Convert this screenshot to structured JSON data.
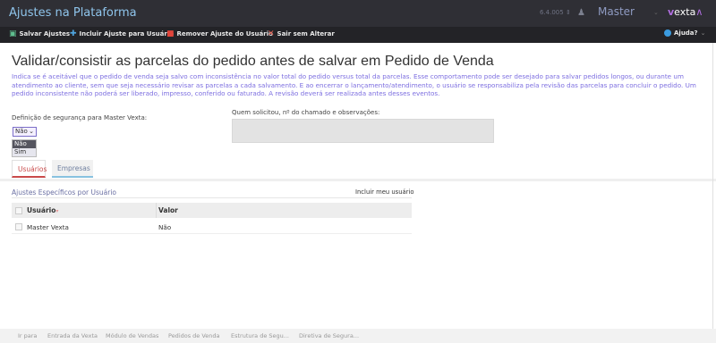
{
  "header": {
    "title": "Ajustes na Plataforma",
    "version": "6.4.005",
    "user": "Master",
    "logo_v": "v",
    "logo_rest": "exta"
  },
  "toolbar": {
    "save": "Salvar Ajustes",
    "include_user": "Incluir Ajuste para Usuário",
    "remove_user": "Remover Ajuste do Usuário",
    "exit": "Sair sem Alterar",
    "help": "Ajuda?"
  },
  "main": {
    "title": "Validar/consistir as parcelas do pedido antes de salvar em Pedido de Venda",
    "description": "Indica se é aceitável que o pedido de venda seja salvo com inconsistência no valor total do pedido versus total da parcelas. Esse comportamento pode ser desejado para salvar pedidos longos, ou durante um atendimento ao cliente, sem que seja necessário revisar as parcelas a cada salvamento. E ao encerrar o lançamento/atendimento, o usuário se responsabiliza pela revisão das parcelas para concluir o pedido. Um pedido inconsistente não poderá ser liberado, impresso, conferido ou faturado. A revisão deverá ser realizada antes desses eventos.",
    "security_label": "Definição de segurança para Master Vexta:",
    "security_value": "Não",
    "security_options": [
      "Não",
      "Sim"
    ],
    "requester_label": "Quem solicitou, nº do chamado e observações:"
  },
  "tabs": [
    {
      "label": "Usuários",
      "active": true
    },
    {
      "label": "Empresas",
      "active": false
    }
  ],
  "section": {
    "title": "Ajustes Específicos por Usuário",
    "include_me": "Incluir meu usuário",
    "columns": [
      "Usuário",
      "Valor"
    ],
    "rows": [
      {
        "user": "Master Vexta",
        "value": "Não"
      }
    ]
  },
  "footer": {
    "items": [
      "Ir para",
      "Entrada da Vexta",
      "Módulo de Vendas",
      "Pedidos de Venda",
      "Estrutura de Segu...",
      "Diretiva de Segura..."
    ]
  },
  "colors": {
    "accent": "#7d6fe0",
    "topbar": "#2f2f35",
    "toolbar": "#232327",
    "tab_active": "#c94a4a"
  }
}
